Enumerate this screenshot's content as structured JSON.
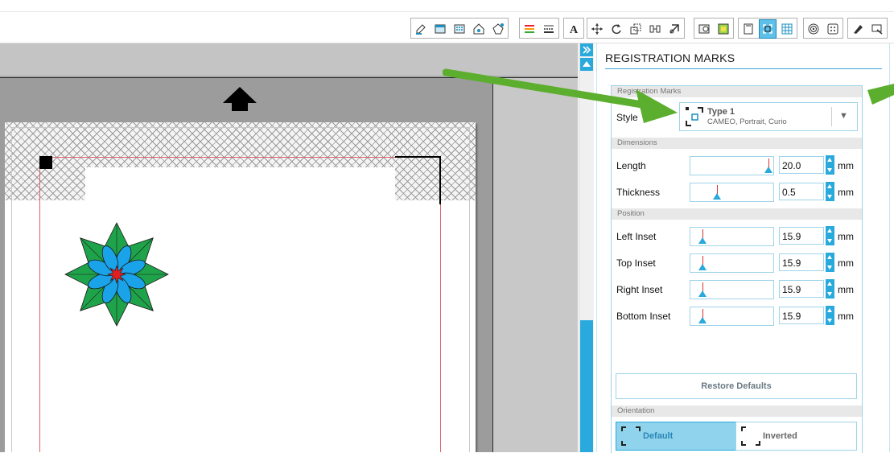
{
  "toolbar": {
    "icons": [
      "pen-icon",
      "fill-icon",
      "pattern-icon",
      "shape-icon",
      "polygon-icon",
      "line-color-icon",
      "line-style-icon",
      "text-icon",
      "transform-icon",
      "rotate-icon",
      "scale-icon",
      "align-icon",
      "move-icon",
      "page-icon",
      "image-icon",
      "page-setup-icon",
      "registration-icon",
      "grid-icon",
      "trace-icon",
      "offset-icon",
      "cut-icon",
      "send-icon"
    ]
  },
  "panel": {
    "title": "REGISTRATION MARKS",
    "sections": {
      "registration": "Registration Marks",
      "dimensions": "Dimensions",
      "position": "Position",
      "orientation": "Orientation"
    },
    "style": {
      "label": "Style",
      "value": "Type 1",
      "description": "CAMEO, Portrait, Curio"
    },
    "fields": {
      "length": {
        "label": "Length",
        "value": "20.0",
        "unit": "mm",
        "level": 1.0
      },
      "thickness": {
        "label": "Thickness",
        "value": "0.5",
        "unit": "mm",
        "level": 0.3
      },
      "left_inset": {
        "label": "Left Inset",
        "value": "15.9",
        "unit": "mm",
        "level": 0.1
      },
      "top_inset": {
        "label": "Top Inset",
        "value": "15.9",
        "unit": "mm",
        "level": 0.1
      },
      "right_inset": {
        "label": "Right Inset",
        "value": "15.9",
        "unit": "mm",
        "level": 0.1
      },
      "bottom_inset": {
        "label": "Bottom Inset",
        "value": "15.9",
        "unit": "mm",
        "level": 0.1
      }
    },
    "restore_label": "Restore Defaults",
    "orientation": {
      "default_label": "Default",
      "inverted_label": "Inverted",
      "selected": "Default"
    }
  },
  "colors": {
    "accent": "#29a9dc",
    "arrow": "#5cae2e",
    "flower_green": "#1fa34a",
    "flower_blue": "#1aa3e8",
    "flower_red": "#e02020"
  }
}
